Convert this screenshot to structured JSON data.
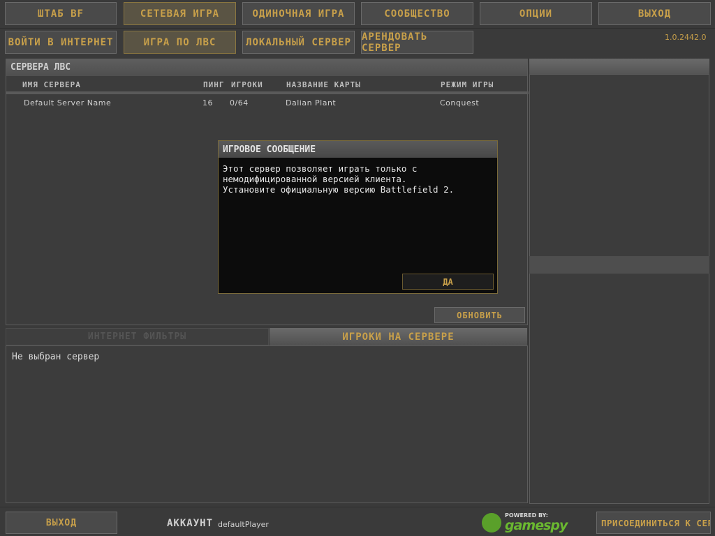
{
  "nav": {
    "hq": "ШТАБ BF",
    "multiplayer": "СЕТЕВАЯ ИГРА",
    "singleplayer": "ОДИНОЧНАЯ ИГРА",
    "community": "СООБЩЕСТВО",
    "options": "ОПЦИИ",
    "exit": "ВЫХОД"
  },
  "subnav": {
    "internet": "ВОЙТИ В ИНТЕРНЕТ",
    "lan": "ИГРА ПО ЛВС",
    "local_server": "ЛОКАЛЬНЫЙ СЕРВЕР",
    "rent_server": "АРЕНДОВАТЬ СЕРВЕР"
  },
  "version": "1.0.2442.0",
  "servers_panel": {
    "title": "СЕРВЕРА ЛВС",
    "columns": {
      "name": "ИМЯ СЕРВЕРА",
      "ping": "ПИНГ",
      "players": "ИГРОКИ",
      "map": "НАЗВАНИЕ КАРТЫ",
      "mode": "РЕЖИМ ИГРЫ"
    },
    "rows": [
      {
        "name": "Default Server Name",
        "ping": "16",
        "players": "0/64",
        "map": "Dalian Plant",
        "mode": "Conquest"
      }
    ],
    "refresh": "ОБНОВИТЬ"
  },
  "tabs": {
    "filters": "ИНТЕРНЕТ ФИЛЬТРЫ",
    "players": "ИГРОКИ НА СЕРВЕРЕ"
  },
  "players_panel": {
    "empty": "Не выбран сервер"
  },
  "modal": {
    "title": "ИГРОВОЕ СООБЩЕНИЕ",
    "text": "Этот сервер позволяет играть только с\nнемодифицированной версией клиента.\nУстановите официальную версию Battlefield 2.",
    "ok": "ДА"
  },
  "bottom": {
    "exit": "ВЫХОД",
    "account_label": "АККАУНТ",
    "account_name": "defaultPlayer",
    "join": "ПРИСОЕДИНИТЬСЯ К СЕРВ",
    "powered_by": "POWERED BY:",
    "gamespy": "gamespy"
  }
}
